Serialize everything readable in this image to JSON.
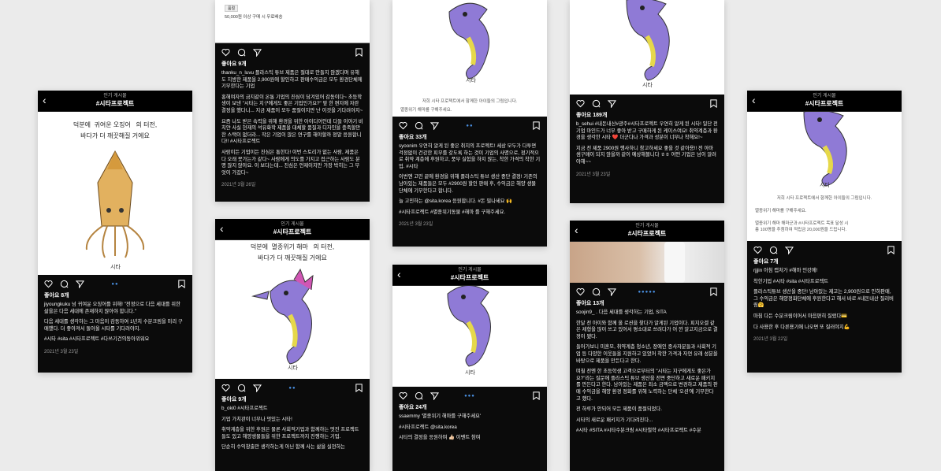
{
  "header_sub": "인기 게시물",
  "header_title": "#시타프로젝트",
  "signature": "시타",
  "drawing_text": {
    "line1": "덕분에",
    "cute_squid": "귀여운 오징어",
    "cute_seahorse": "멸종위기 해마",
    "suffix": "의 터전,",
    "line2": "바다가 더 깨끗해질 거에요"
  },
  "notice": {
    "line1": "저희 시타 프로젝트에서 함께한 아이들의 그림입니다.",
    "line2": "멸종위기 해마를 구해주세요.",
    "line3": "멸종위기 해마 해마군과 #시타프로젝트 목표 달성 시",
    "line4": "총 100명을 추첨하여 적립금 20,000원을 드립니다."
  },
  "product": {
    "badge": "품절",
    "shipping": "50,000원 이상 구매 시 무료배송"
  },
  "posts": [
    {
      "likes": "좋아요 8개",
      "caption": [
        "jiyoungkuku 넘 귀여운 오징어를 위해! \"전정으로 다음 세대를 위한 삶을은 다음 세대에 존재하지 않아야 합니다.\"",
        "다음 세대를 생각하는 그 마음이 감동하여 1년치 수분크림을 미리 구매했다. 더 좋아져서 돌아올 시타를 기다려야지.",
        "#시타 #sita #시타프로젝트 #다쓰기건의동아위워요"
      ],
      "date": "2021년 3월 23일"
    },
    {
      "likes": "좋아요 9개",
      "caption": [
        "thanku_n_luvu 플라스틱 튜브 제품은 절대로 만들지 않겠다며 유해도 지방한 제품을 2,900원에 할인하고 판매수익금은 모두 환경단체에 기부한다는 기업",
        "홍해여자의 금지같이 온통 기업의 진심이 담겨있어 감동이다~ 초등학생이 보낸 \"시타는 지구에게도 좋은 기업인가요?\" 앞 한 편지에 자란 결정을 했다니... 지금 제품이 모두 품절이지만 난 이것을 기다려야지~",
        "요즘 나도 받은 속력을 위해 환경을 위한 아이디어인데 다들 이야기 비치얀 사실 현재의 석유화학 제품을 대체할 품질과 디자인을 충족할만한 스택이 없더라... 작은 기업이 많은 연구를 해야할까 정말 응원합니다!! #시타프로젝트",
        "사람이든 기업이든 진심은 통한다! 이번 스토리가 없는 사람, 제품은 다 오래 못가는가 같다~ 사람에게 의도를 가지고 접근하는 사람도 분명 많지 않아요. 이 보다는데... 진심은 언제이지만 가장 박히는 그 무엇이 가갔다~"
      ],
      "date": "2021년 3월 26일"
    },
    {
      "likes": "좋아요 9개",
      "caption": [
        "b_oki0 #시타프로젝트",
        "기업 가치관이 너무나 멋있는 시타!",
        "취약계층을 위한 후원은 물론 사회적기업과 함께하는 멋진 프로젝트들도 있고 해양생물들을 위한 프로젝트까지 진행하는 기업.",
        "단순히 수익창출만 생각하는게 아닌 함께 사는 삶을 실천하는"
      ]
    },
    {
      "likes": "좋아요 33개",
      "caption": [
        "syoonim 우연히 알게 된 좋은 취지의 프로젝트! 세상 모두가 다투면 걱정없이 건강한 피부를 갖도록 하는 것이 기업의 사명으로, 정기적으로 취약 계층에 후원하고, 풍부 실험을 하지 않는, 착한 가격의 착한 기업. #시타",
        "이번엔 고민 끝에 환경을 위해 플라스틱 튜브 생산 중단 결정! 기존의 남아있는 제품들은 모두 #2900원 할인 판매 후, 수익금은 해양 생물 단체에 기부한다고 합니다.",
        "늘 고민하는 @sita.korea 응원합니다. #돈 필나세요 🙌",
        "#시타프로젝트 #멸종위기동물 #해마 를 구해주세요."
      ],
      "date": "2021년 3월 23일"
    },
    {
      "likes": "좋아요 24개",
      "caption": [
        "ssaemmy '멸종위기 해마를 구해주세요'",
        "#시타프로젝트 @sita.korea",
        "시타의 결정을 응원하며 👍🏻 이벤트 참여"
      ]
    },
    {
      "likes": "좋아요 189개",
      "caption": [
        "b_sehui #내돈내산#광주#시타프로젝트 우연히 알게 된 시타! 일단 전 기업 마인드가 너무 좋아 받고 구매하게 된 케이스여요! 취약계층과 환경을 생각한 시타 ❤️ 더군다나 가격과 성분이 너무나 착해요!~",
        "지금 전 제품 2900원 행사하니 참고하세요 좋을 것 같아용!! 전 아마 샘구매이 되지 않을까 같이 예상해볼니다 ㅎㅎ 어떤 기업은 넘이 알려야해~~"
      ],
      "date": "2021년 3월 23일"
    },
    {
      "likes": "좋아요 13개",
      "caption": [
        "soojin9_ . 다음 세대를 생각하는 기업, SITA",
        "한달 전 아이와 함께 올 로션을 찾다가 알게된 기업이다. 피지오겔 같은 제형을 많이 쓰고 있어서 평소대로 쓰려다가 어 깐 알고지금으로 결정이 됐다.",
        "들어가보니 미혼모, 취약계층 청소년, 장애인 종사자분들과 사회적 기업 등 다양한 이웃들을 지원하고 있었어 착한 가격과 자연 유래 성분을 바탕으로 제품을 만든다고 한다.",
        "며칠 전엔 한 초등학생 고객으로부터의 \"시타는 지구에게도 좋은가요?\"라는 질문에 플라스틱 튜브 생산을 전면 중단하고 새로운 패키지를 만든다고 한다. 남아있는 제품은 최소 금액으로 변경하고 제품의 판매 수익금을 해양 환경 정화를 위해 노력하는 단체 '오션'에 기부한다고 했다.",
        "전 하루가 안되어 모든 제품이 품절되었다.",
        "시타의 새로운 패키지가 기다려진다...",
        "#시타 #SITA #시타수분크림 #시타철학 #시타프로젝트 #수분"
      ]
    },
    {
      "likes": "좋아요 7개",
      "caption": [
        "rjjjin 아침 캡처가 #해마 인강에!",
        "착한기업 #시타 #sita #시타프로젝트",
        "플라스틱튜브 생산을 중단! 남아있는 제고는 2,900원으로 인하판매, 그 수익금은 해양정화단체에 후원한다고 해서 바로 #내돈내산 질러버림🤗",
        "마침 다든 수분크림이어서 마음편히 질렀다💳",
        "다 사용한 후 다른용기에 나오면 또 질러야지💪"
      ],
      "date": "2021년 3월 22일"
    }
  ]
}
